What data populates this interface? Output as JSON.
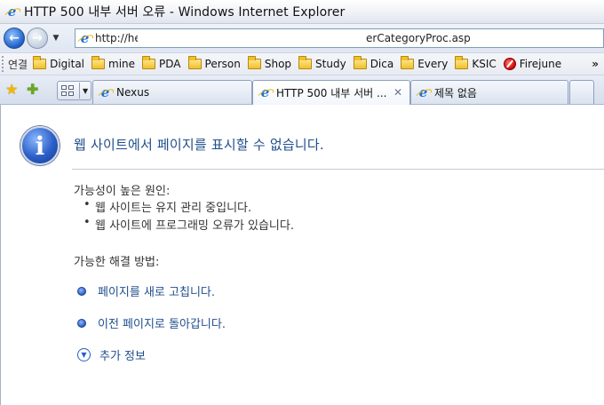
{
  "window": {
    "title": "HTTP 500 내부 서버 오류 - Windows Internet Explorer"
  },
  "address": {
    "url_start": "http://he",
    "url_end": "erCategoryProc.asp"
  },
  "links": {
    "label": "연결",
    "items": [
      "Digital",
      "mine",
      "PDA",
      "Person",
      "Shop",
      "Study",
      "Dica",
      "Every",
      "KSIC",
      "Firejune"
    ],
    "more": "»"
  },
  "tabs": [
    {
      "label": "Nexus"
    },
    {
      "label": "HTTP 500 내부 서버 ..."
    },
    {
      "label": "제목 없음"
    }
  ],
  "content": {
    "headline": "웹 사이트에서 페이지를 표시할 수 없습니다.",
    "causes_title": "가능성이 높은 원인:",
    "causes": [
      "웹 사이트는 유지 관리 중입니다.",
      "웹 사이트에 프로그래밍 오류가 있습니다."
    ],
    "solutions_title": "가능한 해결 방법:",
    "solutions": [
      "페이지를 새로 고칩니다.",
      "이전 페이지로 돌아갑니다."
    ],
    "more_info": "추가 정보"
  },
  "colors": {
    "link_blue": "#1f4e8c",
    "info_icon": "#2b5fc7"
  }
}
